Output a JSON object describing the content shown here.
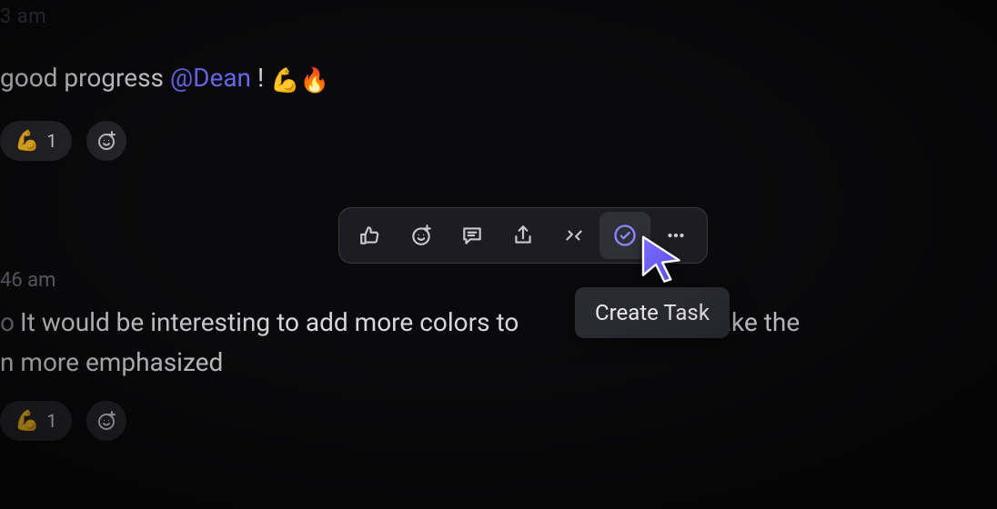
{
  "message1": {
    "timestamp_fragment": "3 am",
    "text_before": "good progress ",
    "mention": "@Dean",
    "text_after": " !",
    "emoji_a": "💪",
    "emoji_b": "🔥"
  },
  "reactions1": {
    "flex": {
      "emoji": "💪",
      "count": "1"
    }
  },
  "message2": {
    "timestamp_fragment": "46 am",
    "prefix": "o",
    "line1": "It would be interesting to add more colors to",
    "line1_tail": "make the",
    "line2": "n more emphasized"
  },
  "reactions2": {
    "flex": {
      "emoji": "💪",
      "count": "1"
    }
  },
  "toolbar": {
    "tooltip": "Create Task"
  }
}
